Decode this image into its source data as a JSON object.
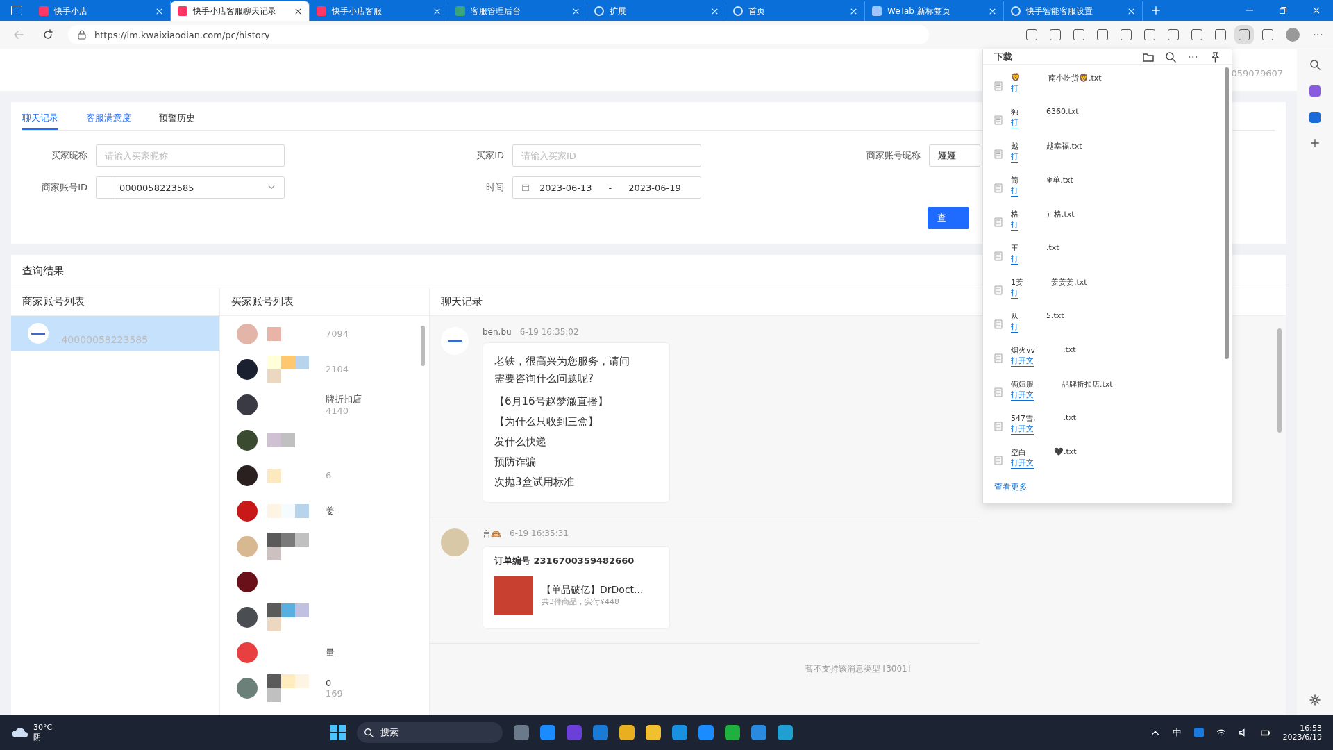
{
  "browser": {
    "tabs": [
      {
        "title": "快手小店",
        "selected": false,
        "kind": "ks"
      },
      {
        "title": "快手小店客服聊天记录",
        "selected": true,
        "kind": "ks"
      },
      {
        "title": "快手小店客服",
        "selected": false,
        "kind": "ks"
      },
      {
        "title": "客服管理后台",
        "selected": false,
        "kind": "admin"
      },
      {
        "title": "扩展",
        "selected": false,
        "kind": "puzzle"
      },
      {
        "title": "首页",
        "selected": false,
        "kind": "loading"
      },
      {
        "title": "WeTab 新标签页",
        "selected": false,
        "kind": "wetab"
      },
      {
        "title": "快手智能客服设置",
        "selected": false,
        "kind": "loading"
      }
    ],
    "url": "https://im.kwaixiaodian.com/pc/history"
  },
  "page": {
    "account_number": "059079607",
    "tabs": [
      {
        "label": "聊天记录",
        "selected": true
      },
      {
        "label": "客服满意度",
        "selected": false
      },
      {
        "label": "预警历史",
        "selected": false
      }
    ],
    "filters": [
      {
        "kind": "text",
        "label": "买家昵称",
        "placeholder": "请输入买家昵称"
      },
      {
        "kind": "text",
        "label": "买家ID",
        "placeholder": "请输入买家ID"
      },
      {
        "kind": "text",
        "label": "商家账号昵称",
        "value": "娅娅"
      },
      {
        "kind": "select",
        "label": "商家账号ID",
        "value": "0000058223585"
      },
      {
        "kind": "daterange",
        "label": "时间",
        "start": "2023-06-13",
        "separator": "-",
        "end": "2023-06-19"
      }
    ],
    "query_button": "查",
    "results": {
      "title": "查询结果",
      "merchant_header": "商家账号列表",
      "merchants": [
        {
          "id": ".40000058223585",
          "selected": true
        }
      ],
      "buyer_header": "买家账号列表",
      "buyers": [
        {
          "kind": "buyer",
          "id": "7094"
        },
        {
          "kind": "buyer",
          "id": "2104"
        },
        {
          "kind": "buyer",
          "name": "牌折扣店",
          "id": "4140"
        },
        {
          "kind": "buyer"
        },
        {
          "kind": "buyer",
          "id": "6"
        },
        {
          "kind": "buyer",
          "name": "姜"
        },
        {
          "kind": "buyer"
        },
        {
          "kind": "buyer"
        },
        {
          "kind": "buyer"
        },
        {
          "kind": "buyer",
          "name": "量"
        },
        {
          "kind": "buyer",
          "name": "0",
          "id": "169"
        }
      ],
      "chat_header": "聊天记录",
      "messages": [
        {
          "kind": "text",
          "sender": "ben.bu",
          "time": "6-19 16:35:02",
          "lines": [
            "老铁，很高兴为您服务，请问需要咨询什么问题呢?",
            "【6月16号赵梦澈直播】",
            "【为什么只收到三盒】",
            "发什么快递",
            "预防诈骗",
            "次抛3盒试用标准"
          ]
        },
        {
          "kind": "order",
          "sender": "言🙉",
          "time": "6-19 16:35:31",
          "order_no": "订单编号 2316700359482660",
          "product": "【单品破亿】DrDoct...",
          "summary": "共3件商品，实付¥448"
        }
      ],
      "notice": "暂不支持该消息类型 [3001]"
    }
  },
  "downloads": {
    "title": "下载",
    "items": [
      {
        "prefix": "🦁",
        "suffix": "南小吃货🦁.txt",
        "link": "打"
      },
      {
        "prefix": "独",
        "suffix": "6360.txt",
        "link": "打"
      },
      {
        "prefix": "越",
        "suffix": "越幸福.txt",
        "link": "打"
      },
      {
        "prefix": "简",
        "suffix": "❄单.txt",
        "link": "打"
      },
      {
        "prefix": "格",
        "suffix": "）格.txt",
        "link": "打"
      },
      {
        "prefix": "王",
        "suffix": ".txt",
        "link": "打"
      },
      {
        "prefix": "1姜",
        "suffix": "姜姜姜.txt",
        "link": "打"
      },
      {
        "prefix": "从",
        "suffix": "5.txt",
        "link": "打"
      },
      {
        "prefix": "烟火vv",
        "suffix": ".txt",
        "link": "打开文"
      },
      {
        "prefix": "俩妞服",
        "suffix": "品牌折扣店.txt",
        "link": "打开文"
      },
      {
        "prefix": "547雪,",
        "suffix": ".txt",
        "link": "打开文"
      },
      {
        "prefix": "空白",
        "suffix": "🖤.txt",
        "link": "打开文"
      }
    ],
    "more": "查看更多"
  },
  "taskbar": {
    "temperature": "30°C",
    "weather": "阴",
    "search_placeholder": "搜索",
    "ime": "中",
    "time": "16:53",
    "date": "2023/6/19"
  }
}
